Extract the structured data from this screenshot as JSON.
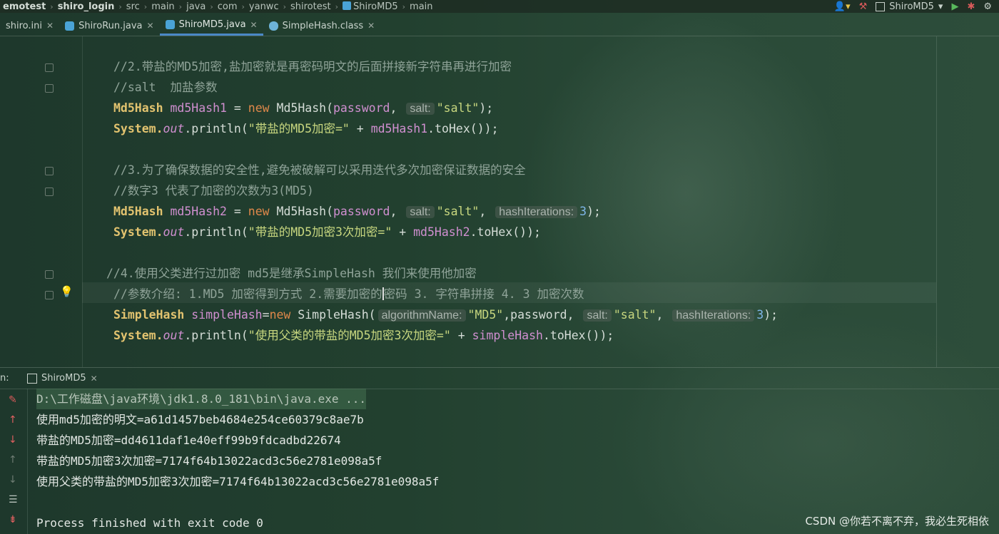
{
  "breadcrumb": [
    "emotest",
    "shiro_login",
    "src",
    "main",
    "java",
    "com",
    "yanwc",
    "shirotest",
    "ShiroMD5",
    "main"
  ],
  "run_config": "ShiroMD5",
  "tabs": [
    {
      "label": "shiro.ini",
      "icon": "ini-file-icon",
      "active": false
    },
    {
      "label": "ShiroRun.java",
      "icon": "java-class-icon",
      "active": false
    },
    {
      "label": "ShiroMD5.java",
      "icon": "java-class-icon",
      "active": true
    },
    {
      "label": "SimpleHash.class",
      "icon": "class-file-icon",
      "active": false
    }
  ],
  "code": {
    "l1": "//2.带盐的MD5加密,盐加密就是再密码明文的后面拼接新字符串再进行加密",
    "l2": "//salt  加盐参数",
    "l3_type": "Md5Hash",
    "l3_var": "md5Hash1",
    "l3_eq": " = ",
    "l3_new": "new",
    "l3_ctor": " Md5Hash(",
    "l3_arg": "password",
    "l3_comma": ", ",
    "hint_salt": "salt:",
    "l3_str": "\"salt\"",
    "l3_end": ");",
    "l4_sys": "System.",
    "l4_out": "out",
    "l4_print": ".println(",
    "l4_str": "\"带盐的MD5加密=\"",
    "l4_plus": " + ",
    "l4_var": "md5Hash1",
    "l4_end": ".toHex());",
    "l6": "//3.为了确保数据的安全性,避免被破解可以采用迭代多次加密保证数据的安全",
    "l7": "//数字3 代表了加密的次数为3(MD5)",
    "l8_type": "Md5Hash",
    "l8_var": "md5Hash2",
    "l8_str": "\"salt\"",
    "hint_iter": "hashIterations:",
    "l8_num": "3",
    "l9_str": "\"带盐的MD5加密3次加密=\"",
    "l9_var": "md5Hash2",
    "l11": "//4.使用父类进行过加密 md5是继承SimpleHash 我们来使用他加密",
    "l12a": "//参数介绍: 1.MD5 加密得到方式 2.需要加密的",
    "l12b": "密码 3. 字符串拼接 4. 3 加密次数",
    "l13_type": "SimpleHash",
    "l13_var": "simpleHash",
    "l13_eq": "=",
    "l13_ctor": " SimpleHash(",
    "hint_alg": "algorithmName:",
    "l13_alg": "\"MD5\"",
    "l13_mid": ",password, ",
    "l13_str": "\"salt\"",
    "l13_comma": ", ",
    "l13_num": "3",
    "l14_str": "\"使用父类的带盐的MD5加密3次加密=\"",
    "l14_var": "simpleHash"
  },
  "run_panel": {
    "label": "n:",
    "tab": "ShiroMD5",
    "lines": [
      "D:\\工作磁盘\\java环境\\jdk1.8.0_181\\bin\\java.exe ...",
      "使用md5加密的明文=a61d1457beb4684e254ce60379c8ae7b",
      "带盐的MD5加密=dd4611daf1e40eff99b9fdcadbd22674",
      "带盐的MD5加密3次加密=7174f64b13022acd3c56e2781e098a5f",
      "使用父类的带盐的MD5加密3次加密=7174f64b13022acd3c56e2781e098a5f",
      "",
      "Process finished with exit code 0"
    ]
  },
  "watermark": "CSDN @你若不离不弃，我必生死相依"
}
